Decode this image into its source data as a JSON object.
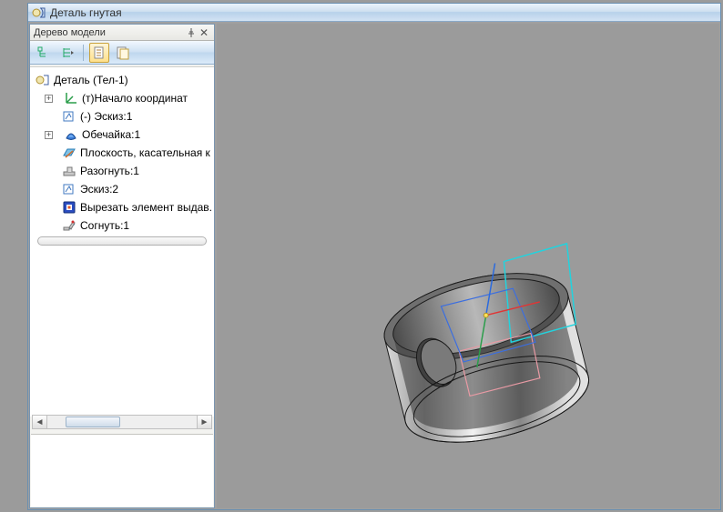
{
  "title": "Деталь гнутая",
  "panel": {
    "header": "Дерево модели"
  },
  "tree": {
    "root": "Деталь (Тел-1)",
    "items": [
      {
        "label": "(т)Начало координат",
        "expandable": true
      },
      {
        "label": "(-) Эскиз:1"
      },
      {
        "label": "Обечайка:1",
        "expandable": true
      },
      {
        "label": "Плоскость, касательная к"
      },
      {
        "label": "Разогнуть:1"
      },
      {
        "label": "Эскиз:2"
      },
      {
        "label": "Вырезать элемент выдав."
      },
      {
        "label": "Согнуть:1"
      }
    ]
  }
}
